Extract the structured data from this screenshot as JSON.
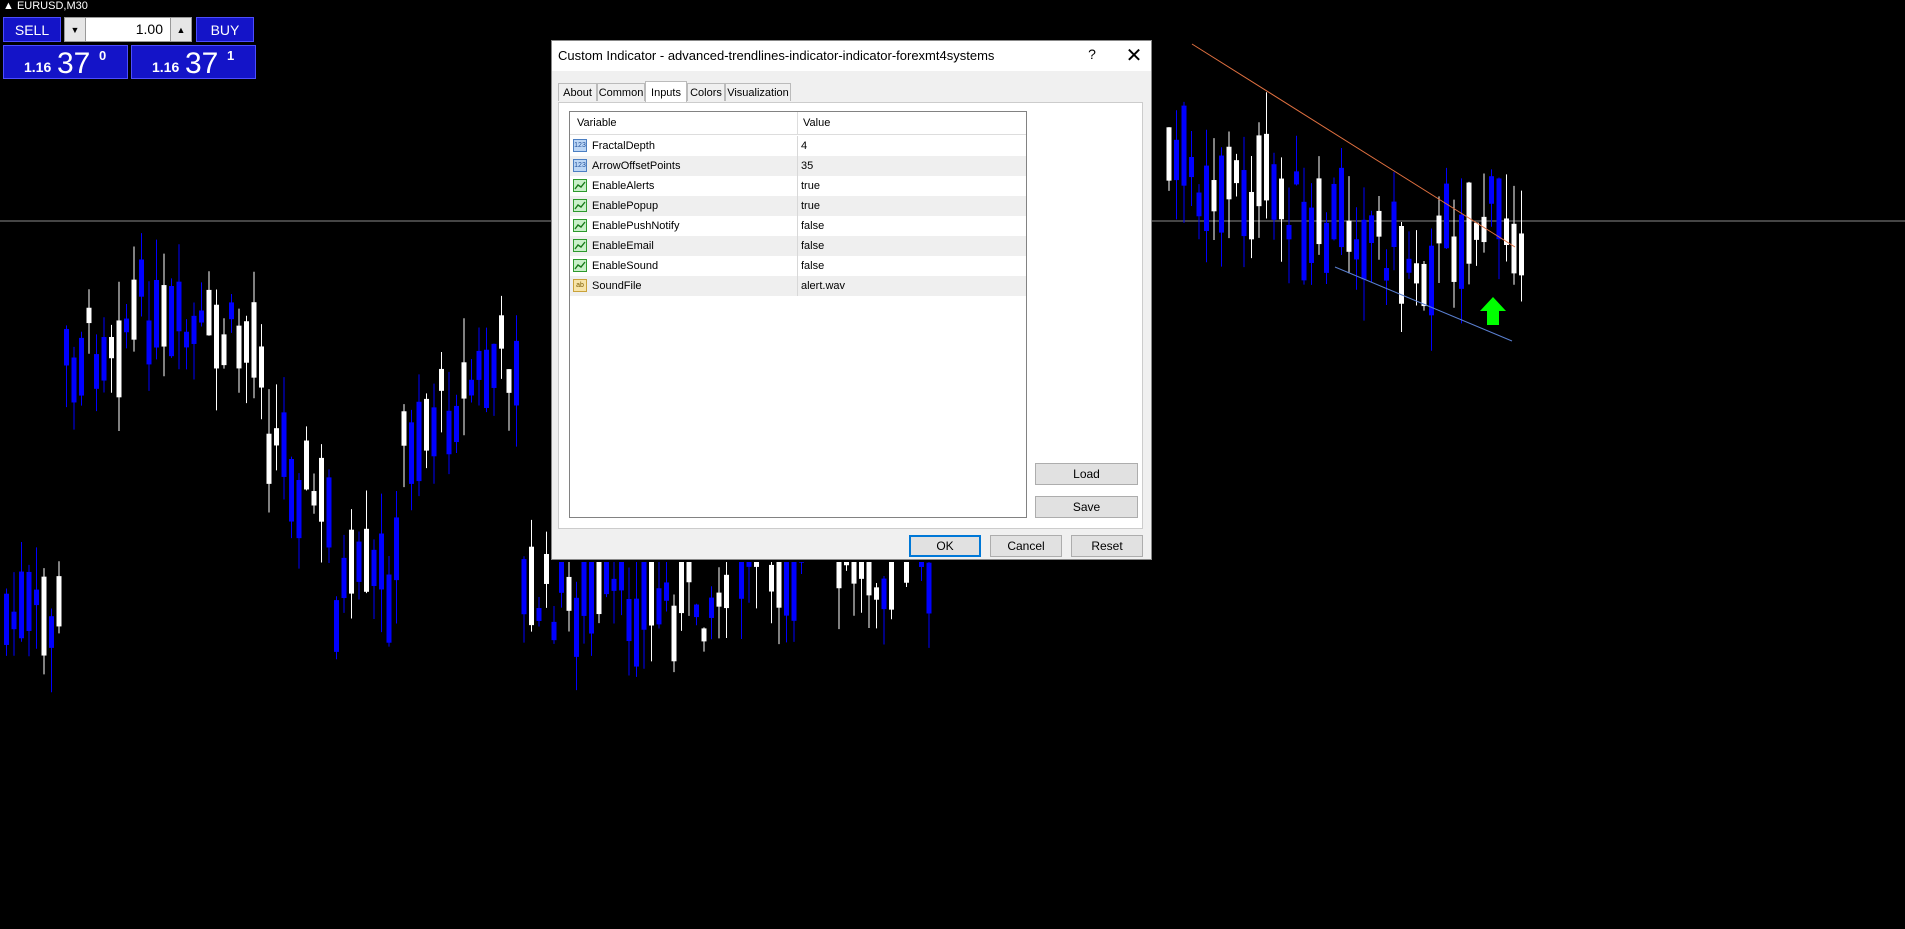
{
  "chart": {
    "symbol": "EURUSD,M30",
    "background_color": "#000000",
    "bull_color": "#ffffff",
    "bear_color": "#0000ff",
    "upper_trendline_color": "#e07040",
    "lower_trendline_color": "#5a7fd0",
    "signal_arrow_color": "#00ff00",
    "signal": "up-arrow"
  },
  "trade_panel": {
    "sell_label": "SELL",
    "buy_label": "BUY",
    "lot_size": "1.00",
    "sell_price_small": "1.16",
    "sell_price_big": "37",
    "sell_price_sup": "0",
    "buy_price_small": "1.16",
    "buy_price_big": "37",
    "buy_price_sup": "1",
    "button_color": "#1414c8"
  },
  "dialog": {
    "title": "Custom Indicator - advanced-trendlines-indicator-indicator-forexmt4systems",
    "help": "?",
    "close": "✕",
    "tabs": [
      "About",
      "Common",
      "Inputs",
      "Colors",
      "Visualization"
    ],
    "active_tab": "Inputs",
    "grid": {
      "col_variable": "Variable",
      "col_value": "Value",
      "rows": [
        {
          "name": "FractalDepth",
          "value": "4",
          "type": "int",
          "icon": "123"
        },
        {
          "name": "ArrowOffsetPoints",
          "value": "35",
          "type": "int",
          "icon": "123"
        },
        {
          "name": "EnableAlerts",
          "value": "true",
          "type": "bool",
          "icon": "bool-icon"
        },
        {
          "name": "EnablePopup",
          "value": "true",
          "type": "bool",
          "icon": "bool-icon"
        },
        {
          "name": "EnablePushNotify",
          "value": "false",
          "type": "bool",
          "icon": "bool-icon"
        },
        {
          "name": "EnableEmail",
          "value": "false",
          "type": "bool",
          "icon": "bool-icon"
        },
        {
          "name": "EnableSound",
          "value": "false",
          "type": "bool",
          "icon": "bool-icon"
        },
        {
          "name": "SoundFile",
          "value": "alert.wav",
          "type": "string",
          "icon": "ab"
        }
      ]
    },
    "load_label": "Load",
    "save_label": "Save",
    "ok_label": "OK",
    "cancel_label": "Cancel",
    "reset_label": "Reset"
  }
}
